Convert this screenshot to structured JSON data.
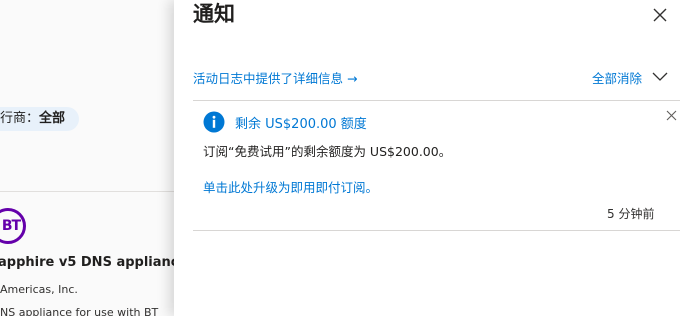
{
  "background_page": {
    "filter_label": "行商：",
    "filter_value": "全部",
    "logo_text": "BT",
    "product_title": "apphire v5 DNS appliance",
    "publisher": "Americas, Inc.",
    "description": "NS appliance for use with BT"
  },
  "notifications_pane": {
    "title": "通知",
    "activity_log_link": "活动日志中提供了详细信息 →",
    "dismiss_all": "全部消除",
    "notifications": [
      {
        "title": "剩余 US$200.00 额度",
        "message": "订阅“免费试用”的剩余额度为 US$200.00。",
        "link": "单击此处升级为即用即付订阅。",
        "time": "5 分钟前",
        "type": "info"
      }
    ]
  },
  "colors": {
    "accent": "#0078d4",
    "logo": "#6400aa",
    "pill_bg": "#e8f1fa"
  },
  "icons": {
    "close": "close-icon",
    "chevron": "chevron-down-icon",
    "info": "info-icon"
  }
}
